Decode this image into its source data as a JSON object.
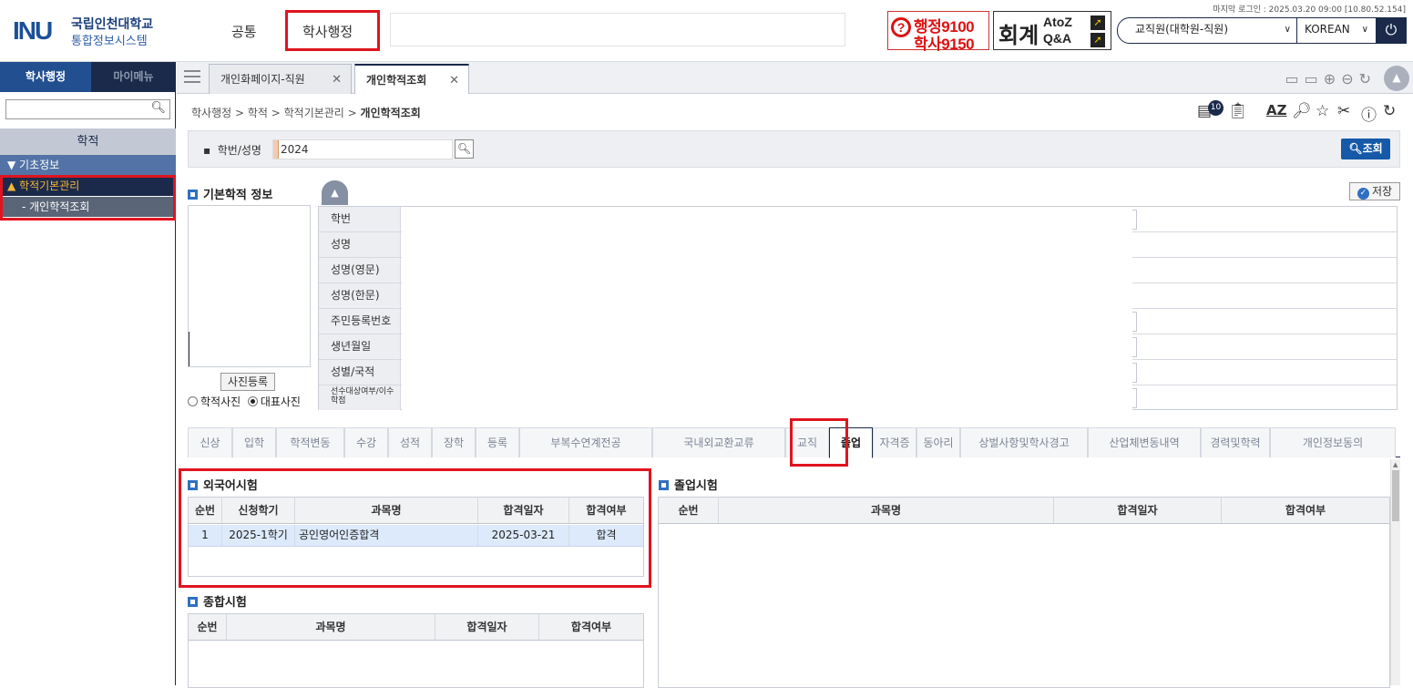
{
  "header": {
    "logo_mark": "INU",
    "logo_line1": "국립인천대학교",
    "logo_line2": "통합정보시스템",
    "menu_common": "공통",
    "menu_academic": "학사행정",
    "last_login": "마지막 로그인 : 2025.03.20 09:00 [10.80.52.154]",
    "banner_admin": "행정9100",
    "banner_academic": "학사9150",
    "banner_accounting": "회계",
    "banner_atoz": "AtoZ",
    "banner_qa": "Q&A",
    "role_select": "교직원(대학원-직원)",
    "lang_select": "KOREAN"
  },
  "sidebar": {
    "tab_academic": "학사행정",
    "tab_mymenu": "마이메뉴",
    "section": "학적",
    "items": [
      {
        "label": "▼ 기초정보"
      },
      {
        "label": "▲ 학적기본관리"
      },
      {
        "label": "- 개인학적조회"
      }
    ]
  },
  "tabs": [
    {
      "label": "개인화페이지-직원"
    },
    {
      "label": "개인학적조회"
    }
  ],
  "breadcrumb": {
    "path": "학사행정 > 학적 > 학적기본관리 > ",
    "current": "개인학적조회"
  },
  "toolbar": {
    "badge_count": "10"
  },
  "search": {
    "label": "학번/성명",
    "value": "2024",
    "query_button": "조회"
  },
  "basic_info": {
    "title": "기본학적 정보",
    "save_button": "저장",
    "photo_register": "사진등록",
    "radio_academic_photo": "학적사진",
    "radio_rep_photo": "대표사진",
    "fields": [
      {
        "label": "학번"
      },
      {
        "label": "성명"
      },
      {
        "label": "성명(영문)"
      },
      {
        "label": "성명(한문)"
      },
      {
        "label": "주민등록번호"
      },
      {
        "label": "생년월일"
      },
      {
        "label": "성별/국적"
      },
      {
        "label": "선수대상여부/이수학점"
      }
    ]
  },
  "subtabs": [
    {
      "label": "신상"
    },
    {
      "label": "입학"
    },
    {
      "label": "학적변동"
    },
    {
      "label": "수강"
    },
    {
      "label": "성적"
    },
    {
      "label": "장학"
    },
    {
      "label": "등록"
    },
    {
      "label": "부복수연계전공"
    },
    {
      "label": "국내외교환교류"
    },
    {
      "label": "교직"
    },
    {
      "label": "졸업"
    },
    {
      "label": "자격증"
    },
    {
      "label": "동아리"
    },
    {
      "label": "상벌사항및학사경고"
    },
    {
      "label": "산업체변동내역"
    },
    {
      "label": "경력및학력"
    },
    {
      "label": "개인정보동의"
    }
  ],
  "foreign_exam": {
    "title": "외국어시험",
    "columns": [
      "순번",
      "신청학기",
      "과목명",
      "합격일자",
      "합격여부"
    ],
    "rows": [
      [
        "1",
        "2025-1학기",
        "공인영어인증합격",
        "2025-03-21",
        "합격"
      ]
    ]
  },
  "graduation_exam": {
    "title": "졸업시험",
    "columns": [
      "순번",
      "과목명",
      "합격일자",
      "합격여부"
    ]
  },
  "comprehensive_exam": {
    "title": "종합시험",
    "columns": [
      "순번",
      "과목명",
      "합격일자",
      "합격여부"
    ]
  },
  "colors": {
    "navy": "#1b2a4a",
    "accent_blue": "#1659a8",
    "highlight_red": "#e0141e",
    "selected_row": "#ddeafc"
  }
}
